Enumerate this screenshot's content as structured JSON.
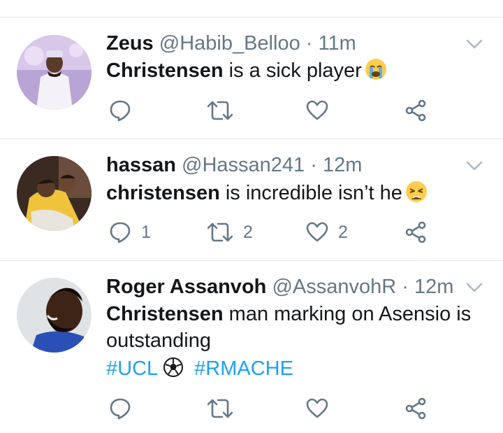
{
  "tweets": [
    {
      "name": "Zeus",
      "handle": "@Habib_Belloo",
      "time": "11m",
      "body_bold": "Christensen",
      "body_rest": " is a sick player",
      "emoji": "crying-face-emoji",
      "hashtags": [],
      "reply_count": "",
      "retweet_count": "",
      "like_count": ""
    },
    {
      "name": "hassan",
      "handle": "@Hassan241",
      "time": "12m",
      "body_bold": "christensen",
      "body_rest": " is incredible isn’t he",
      "emoji": "weary-face-emoji",
      "hashtags": [],
      "reply_count": "1",
      "retweet_count": "2",
      "like_count": "2"
    },
    {
      "name": "Roger Assanvoh",
      "handle": "@AssanvohR",
      "time": "12m",
      "body_bold": "Christensen",
      "body_rest": " man marking on Asensio is outstanding",
      "emoji": "",
      "hashtags": [
        "#UCL",
        "#RMACHE"
      ],
      "hashtag_emoji": "soccer-ball-emoji",
      "reply_count": "",
      "retweet_count": "",
      "like_count": ""
    }
  ],
  "separator": "·",
  "colors": {
    "text": "#14171a",
    "meta": "#657786",
    "link": "#1da1f2",
    "divider": "#e1e8ed",
    "icon": "#657786"
  },
  "icons": [
    "reply-icon",
    "retweet-icon",
    "like-icon",
    "share-icon",
    "chevron-down-icon"
  ]
}
